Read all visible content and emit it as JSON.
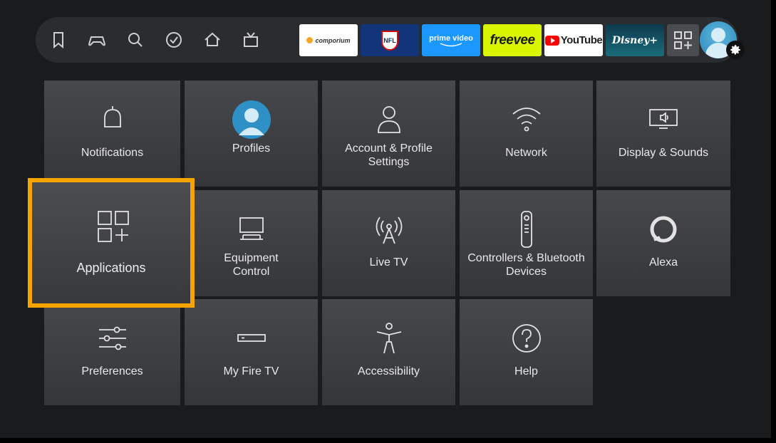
{
  "topbar": {
    "nav_icons": [
      "bookmark-icon",
      "gamepad-icon",
      "search-icon",
      "check-circle-icon",
      "home-icon",
      "live-tv-icon"
    ],
    "apps": [
      {
        "name": "comporium",
        "label": "comporium"
      },
      {
        "name": "nfl",
        "label": "NFL"
      },
      {
        "name": "prime-video",
        "label": "prime video"
      },
      {
        "name": "freevee",
        "label": "freevee"
      },
      {
        "name": "youtube",
        "label": "YouTube"
      },
      {
        "name": "disney-plus",
        "label": "Disney+"
      }
    ]
  },
  "settings": {
    "notifications": "Notifications",
    "profiles": "Profiles",
    "account_line1": "Account & Profile",
    "account_line2": "Settings",
    "network": "Network",
    "display": "Display & Sounds",
    "applications": "Applications",
    "equipment_line1": "Equipment",
    "equipment_line2": "Control",
    "live_tv": "Live TV",
    "controllers_line1": "Controllers & Bluetooth",
    "controllers_line2": "Devices",
    "alexa": "Alexa",
    "preferences": "Preferences",
    "my_fire_tv": "My Fire TV",
    "accessibility": "Accessibility",
    "help": "Help"
  },
  "colors": {
    "focus_border": "#f5a400",
    "tile": "#46484b",
    "background": "#1a1b1d"
  }
}
